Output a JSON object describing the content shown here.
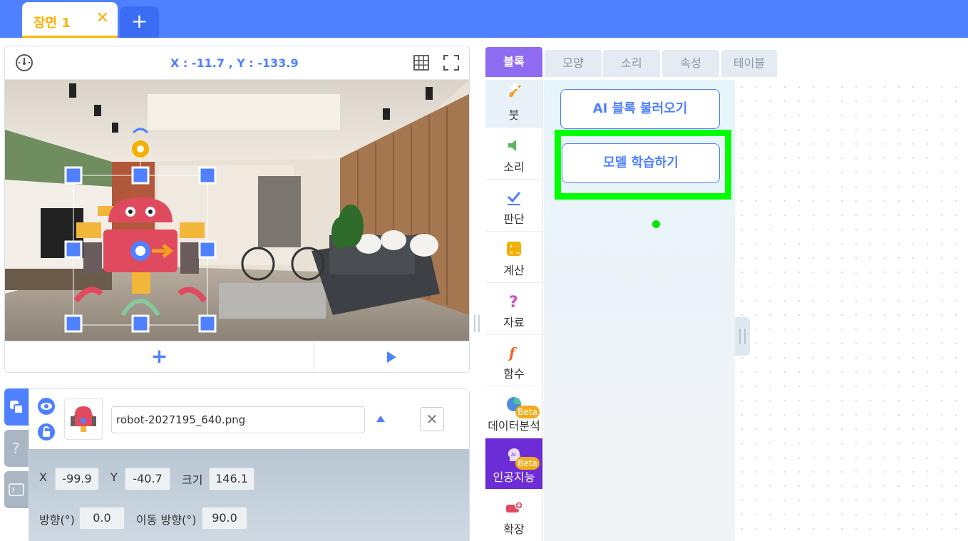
{
  "scene": {
    "tab_label": "장면 1",
    "close_glyph": "✕",
    "add_glyph": "+"
  },
  "stage": {
    "coords": "X : -11.7 , Y : -133.9",
    "add_object_glyph": "+",
    "icons": [
      "speedometer-icon",
      "grid-icon",
      "fullscreen-icon",
      "play-icon"
    ]
  },
  "object": {
    "name": "robot-2027195_640.png",
    "x_label": "X",
    "x": "-99.9",
    "y_label": "Y",
    "y": "-40.7",
    "size_label": "크기",
    "size": "146.1",
    "direction_label": "방향(°)",
    "direction": "0.0",
    "move_direction_label": "이동 방향(°)",
    "move_direction": "90.0",
    "delete_glyph": "✕"
  },
  "tabs": [
    "블록",
    "모양",
    "소리",
    "속성",
    "테이블"
  ],
  "active_tab": "블록",
  "categories": [
    {
      "label": "붓",
      "icon": "brush-icon"
    },
    {
      "label": "소리",
      "icon": "speaker-icon"
    },
    {
      "label": "판단",
      "icon": "check-icon"
    },
    {
      "label": "계산",
      "icon": "calculator-icon"
    },
    {
      "label": "자료",
      "icon": "question-icon"
    },
    {
      "label": "함수",
      "icon": "function-icon"
    },
    {
      "label": "데이터분석",
      "icon": "pie-chart-icon",
      "badge": "Beta"
    },
    {
      "label": "인공지능",
      "icon": "ai-head-icon",
      "badge": "Beta"
    },
    {
      "label": "확장",
      "icon": "extension-icon"
    }
  ],
  "selected_category": "인공지능",
  "blocks": {
    "load_ai": "AI 블록 불러오기",
    "train_model": "모델 학습하기"
  },
  "colors": {
    "accent": "#4f80ff",
    "tab_active": "#8f6bf2",
    "category_selected": "#6c2cd6",
    "highlight": "#00ff00",
    "scene_tab": "#ffb000"
  }
}
